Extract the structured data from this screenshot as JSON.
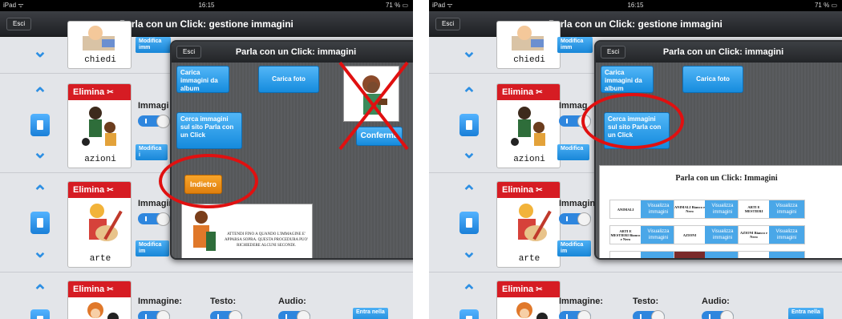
{
  "left": {
    "status": {
      "carrier": "iPad ᯤ",
      "time": "16:15",
      "battery": "71 % ▭"
    },
    "nav": {
      "title": "Parla con un Click: gestione immagini",
      "exit": "Esci"
    },
    "rows": [
      {
        "label": "chiedi",
        "edit": "Modifica imm"
      },
      {
        "delete": "Elimina",
        "label": "azioni",
        "image_label": "Immagi",
        "edit": "Modifica i"
      },
      {
        "delete": "Elimina",
        "label": "arte",
        "image_label": "Immagin",
        "edit": "Modifica im"
      },
      {
        "delete": "Elimina",
        "image_label": "Immagine:",
        "text_label": "Testo:",
        "audio_label": "Audio:",
        "enter": "Entra nella"
      }
    ],
    "popover": {
      "title": "Parla con un Click: immagini",
      "exit": "Esci",
      "load_album": "Carica immagini da album",
      "load_photo": "Carica foto",
      "search_site": "Cerca immagini sul sito Parla con un Click",
      "confirm": "Conferma",
      "back": "Indietro",
      "notice": "ATTENDI FINO A QUANDO L'IMMAGINE E' APPARSA SOPRA. QUESTA PROCEDURA PUO' RICHIEDERE ALCUNI SECONDI."
    }
  },
  "right": {
    "status": {
      "carrier": "iPad ᯤ",
      "time": "16:15",
      "battery": "71 % ▭"
    },
    "nav": {
      "title": "Parla con un Click: gestione immagini",
      "exit": "Esci"
    },
    "rows": [
      {
        "label": "chiedi",
        "edit": "Modifica imm"
      },
      {
        "delete": "Elimina",
        "label": "azioni",
        "image_label": "Immag",
        "edit": "Modifica"
      },
      {
        "delete": "Elimina",
        "label": "arte",
        "image_label": "Immagin",
        "edit": "Modifica im"
      },
      {
        "delete": "Elimina",
        "image_label": "Immagine:",
        "text_label": "Testo:",
        "audio_label": "Audio:",
        "enter": "Entra nella"
      }
    ],
    "popover": {
      "title": "Parla con un Click: immagini",
      "exit": "Esci",
      "load_album": "Carica immagini da album",
      "load_photo": "Carica foto",
      "search_site": "Cerca immagini sul sito Parla con un Click",
      "site_title": "Parla con un Click: Immagini",
      "view_button": "Visualizza immagini",
      "categories": [
        "ANIMALI",
        "ANIMALI Bianco e Nero",
        "ARTI E MESTIERI",
        "ARTI E MESTIERI Bianco e Nero",
        "AZIONI",
        "AZIONI Bianco e Nero",
        "",
        "BAMBINI E F",
        ""
      ]
    }
  },
  "colors": {
    "accent": "#2d8fe3",
    "delete": "#d61c23",
    "annotation": "#e01010",
    "back": "#ef8f1a"
  }
}
